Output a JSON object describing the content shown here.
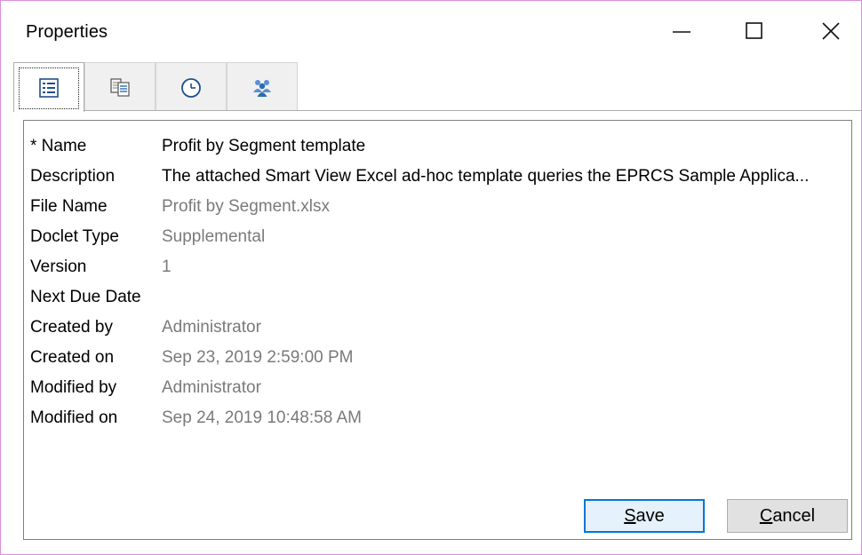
{
  "window": {
    "title": "Properties",
    "controls": {
      "minimize": "—",
      "maximize": "☐",
      "close": "✕"
    }
  },
  "tabs": [
    {
      "icon": "properties-list-icon",
      "active": true
    },
    {
      "icon": "document-clipboard-icon",
      "active": false
    },
    {
      "icon": "clock-icon",
      "active": false
    },
    {
      "icon": "users-group-icon",
      "active": false
    }
  ],
  "properties": [
    {
      "label": "* Name",
      "value": "Profit by Segment template",
      "editable": true
    },
    {
      "label": "Description",
      "value": "The attached Smart View Excel ad-hoc template queries the EPRCS Sample Applica...",
      "editable": true
    },
    {
      "label": "File Name",
      "value": "Profit by Segment.xlsx",
      "editable": false
    },
    {
      "label": "Doclet Type",
      "value": "Supplemental",
      "editable": false
    },
    {
      "label": "Version",
      "value": "1",
      "editable": false
    },
    {
      "label": "Next Due Date",
      "value": "",
      "editable": false
    },
    {
      "label": "Created by",
      "value": "Administrator",
      "editable": false
    },
    {
      "label": "Created on",
      "value": "Sep 23, 2019 2:59:00 PM",
      "editable": false
    },
    {
      "label": "Modified by",
      "value": "Administrator",
      "editable": false
    },
    {
      "label": "Modified on",
      "value": "Sep 24, 2019 10:48:58 AM",
      "editable": false
    }
  ],
  "buttons": {
    "save": {
      "mnemonic": "S",
      "rest": "ave"
    },
    "cancel": {
      "mnemonic": "C",
      "rest": "ancel"
    }
  },
  "colors": {
    "window_border": "#d98fd9",
    "readonly_text": "#7a7a7a",
    "default_button_border": "#0078d7",
    "icon_blue": "#2b6cb0"
  }
}
